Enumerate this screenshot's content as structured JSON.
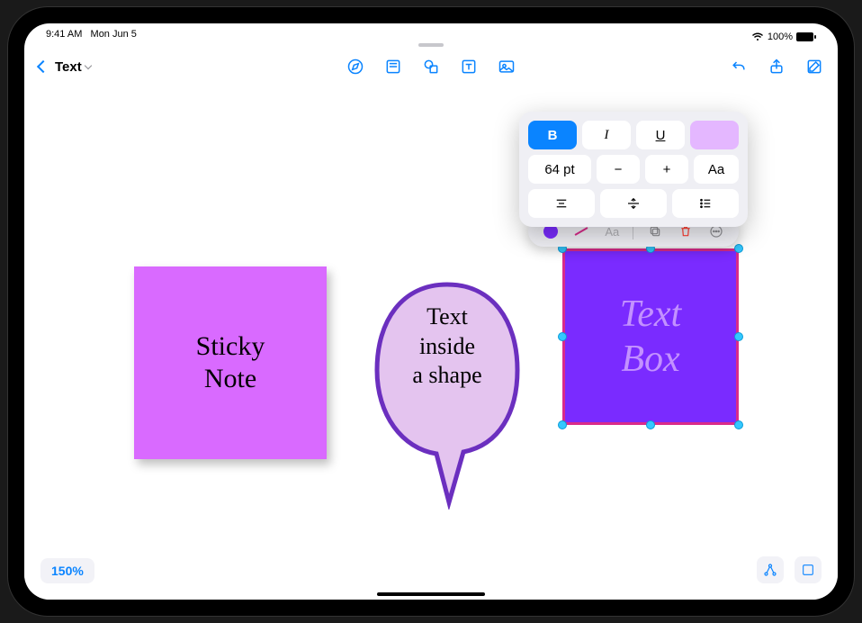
{
  "status": {
    "time": "9:41 AM",
    "date": "Mon Jun 5",
    "battery": "100%"
  },
  "header": {
    "board_title": "Text"
  },
  "canvas": {
    "sticky_note_text": "Sticky\nNote",
    "speech_bubble_text": "Text\ninside\na shape",
    "text_box_text": "Text\nBox",
    "zoom_label": "150%"
  },
  "format": {
    "bold_label": "B",
    "italic_label": "I",
    "underline_label": "U",
    "font_size": "64 pt",
    "text_options_label": "Aa",
    "context_text_label": "Aa"
  },
  "colors": {
    "accent": "#0a84ff",
    "sticky": "#d96aff",
    "speech_fill": "#e4c4ef",
    "speech_stroke": "#6b2fbf",
    "textbox_fill": "#7a2bff",
    "textbox_border": "#d92b8a",
    "swatch": "#e4b7ff"
  }
}
